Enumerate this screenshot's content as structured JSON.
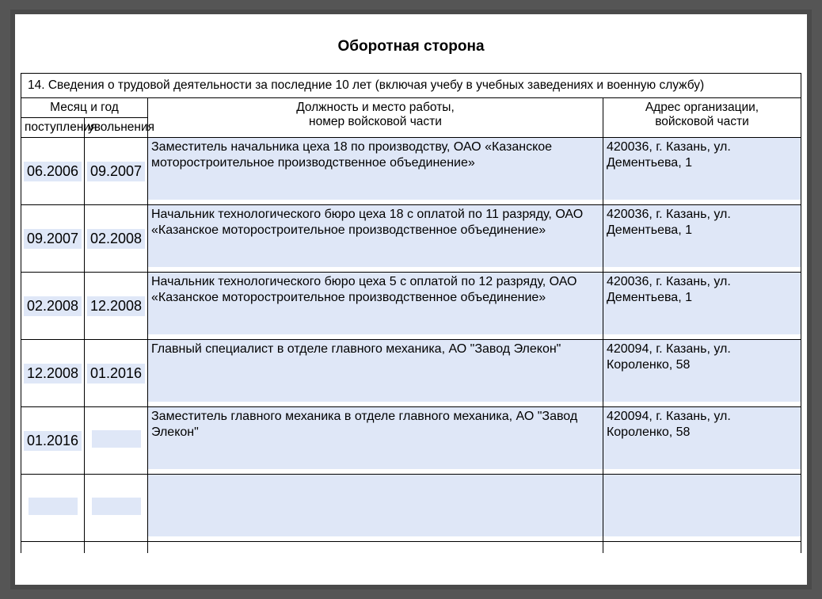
{
  "title": "Оборотная сторона",
  "header14": "14. Сведения о трудовой деятельности за последние 10 лет (включая учебу в учебных заведениях и военную службу)",
  "headers": {
    "month_year": "Месяц и год",
    "position": "Должность и место работы,",
    "unit": "номер войсковой части",
    "address": "Адрес организации,",
    "addr_unit": "войсковой части",
    "start": "поступления",
    "end": "увольнения"
  },
  "rows": [
    {
      "start": "06.2006",
      "end": "09.2007",
      "position": "Заместитель начальника цеха 18 по производству, ОАО «Казанское моторостроительное производственное объединение»",
      "address": "420036, г. Казань, ул. Дементьева, 1"
    },
    {
      "start": "09.2007",
      "end": "02.2008",
      "position": "Начальник технологического бюро цеха 18 с оплатой по 11 разряду, ОАО «Казанское моторостроительное производственное объединение»",
      "address": "420036, г. Казань, ул. Дементьева, 1"
    },
    {
      "start": "02.2008",
      "end": "12.2008",
      "position": "Начальник технологического бюро цеха 5 с оплатой по 12 разряду, ОАО «Казанское моторостроительное производственное объединение»",
      "address": "420036, г. Казань, ул. Дементьева, 1"
    },
    {
      "start": "12.2008",
      "end": "01.2016",
      "position": "Главный специалист в отделе главного механика, АО \"Завод Элекон\"",
      "address": "420094, г.  Казань, ул. Короленко, 58"
    },
    {
      "start": "01.2016",
      "end": "",
      "position": "Заместитель главного механика в отделе главного механика, АО \"Завод Элекон\"",
      "address": "420094, г.  Казань, ул. Короленко, 58"
    },
    {
      "start": "",
      "end": "",
      "position": "",
      "address": ""
    }
  ]
}
